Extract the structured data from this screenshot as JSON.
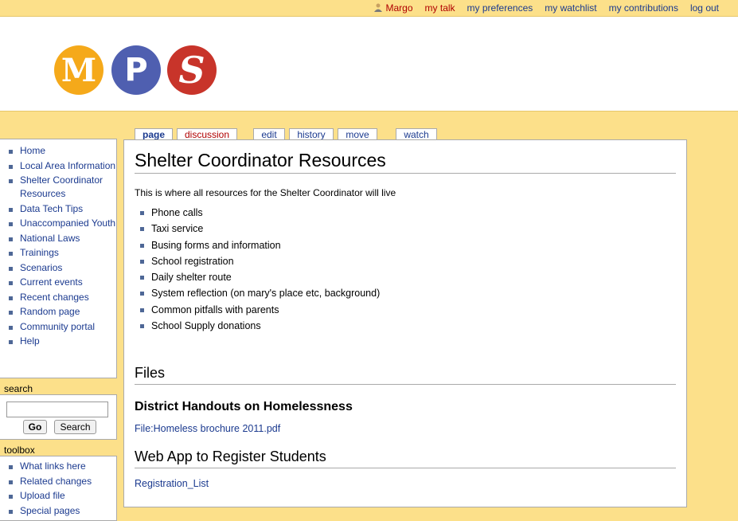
{
  "personal": {
    "user": "Margo",
    "items": [
      "my talk",
      "my preferences",
      "my watchlist",
      "my contributions",
      "log out"
    ]
  },
  "logo": {
    "letters": [
      "M",
      "P",
      "S"
    ],
    "colors": [
      "#f5a91a",
      "#4f5fb0",
      "#c8342a"
    ]
  },
  "tabs": {
    "page": "page",
    "discussion": "discussion",
    "edit": "edit",
    "history": "history",
    "move": "move",
    "watch": "watch"
  },
  "content": {
    "title": "Shelter Coordinator Resources",
    "intro": "This is where all resources for the Shelter Coordinator will live",
    "bullets": [
      "Phone calls",
      "Taxi service",
      "Busing forms and information",
      "School registration",
      "Daily shelter route",
      "System reflection (on mary's place etc, background)",
      "Common pitfalls with parents",
      "School Supply donations"
    ],
    "files_heading": "Files",
    "district_heading": "District Handouts on Homelessness",
    "file_link": "File:Homeless brochure 2011.pdf",
    "webapp_heading": "Web App to Register Students",
    "registration_link": "Registration_List"
  },
  "navigation": {
    "items": [
      "Home",
      "Local Area Information",
      "Shelter Coordinator Resources",
      "Data Tech Tips",
      "Unaccompanied Youth",
      "National Laws",
      "Trainings",
      "Scenarios",
      "Current events",
      "Recent changes",
      "Random page",
      "Community portal",
      "Help"
    ]
  },
  "search": {
    "label": "search",
    "value": "",
    "go": "Go",
    "search": "Search"
  },
  "toolbox": {
    "label": "toolbox",
    "items": [
      "What links here",
      "Related changes",
      "Upload file",
      "Special pages"
    ]
  },
  "colors": {
    "page_bg": "#fce08a",
    "link": "#1b3a8f",
    "red_link": "#b00000"
  }
}
